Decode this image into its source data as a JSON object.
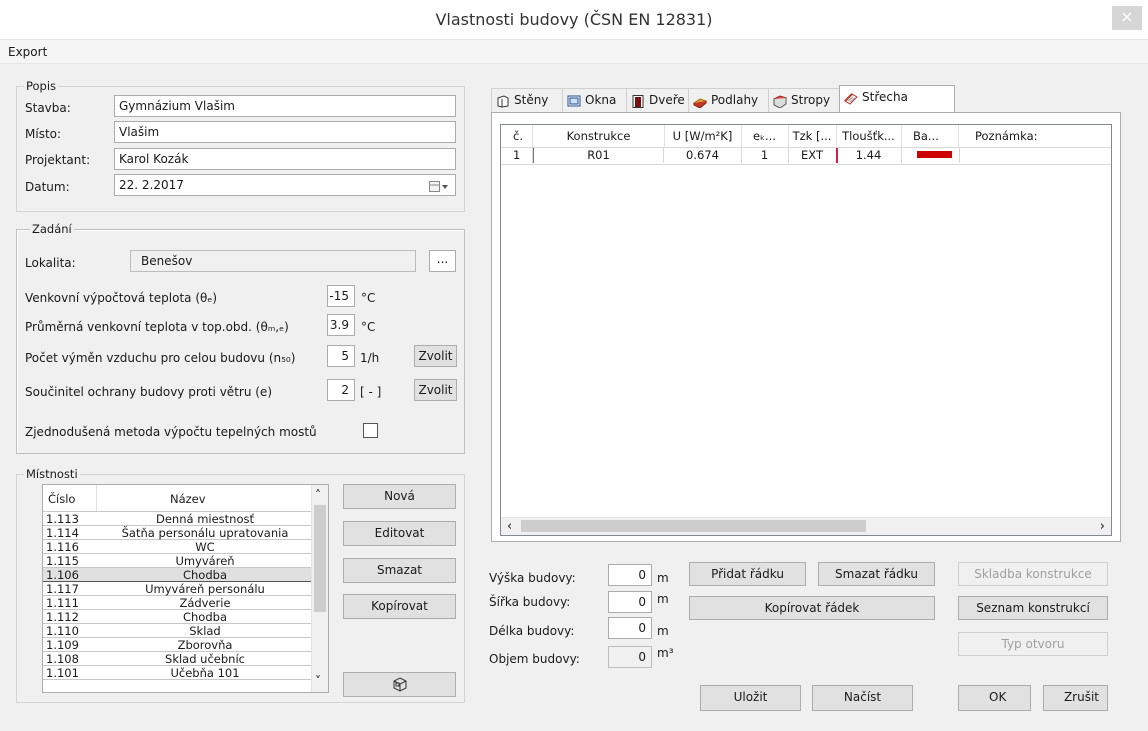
{
  "window": {
    "title": "Vlastnosti budovy (ČSN EN 12831)",
    "close_glyph": "×"
  },
  "menu": {
    "export": "Export"
  },
  "popis": {
    "group_label": "Popis",
    "stavba_label": "Stavba:",
    "stavba_value": "Gymnázium Vlašim",
    "misto_label": "Místo:",
    "misto_value": "Vlašim",
    "projektant_label": "Projektant:",
    "projektant_value": "Karol Kozák",
    "datum_label": "Datum:",
    "datum_value": "22. 2.2017"
  },
  "zadani": {
    "group_label": "Zadání",
    "lokalita_label": "Lokalita:",
    "lokalita_value": "Benešov",
    "lokalita_button": "...",
    "venkovni_label": "Venkovní výpočtová teplota (θₑ)",
    "venkovni_value": "-15",
    "venkovni_unit": "°C",
    "prumerna_label": "Průměrná venkovní teplota v top.obd. (θₘ,ₑ)",
    "prumerna_value": "3.9",
    "prumerna_unit": "°C",
    "vymen_label": "Počet výměn vzduchu pro celou budovu (n₅₀)",
    "vymen_value": "5",
    "vymen_unit": "1/h",
    "vymen_button": "Zvolit",
    "soucinitel_label": "Součinitel ochrany budovy proti větru (e)",
    "soucinitel_value": "2",
    "soucinitel_unit": "[ - ]",
    "soucinitel_button": "Zvolit",
    "zjednodusena_label": "Zjednodušená metoda výpočtu tepelných mostů",
    "zjednodusena_checked": false
  },
  "mistnosti": {
    "group_label": "Místnosti",
    "columns": [
      "Číslo",
      "Název"
    ],
    "rows": [
      {
        "cislo": "1.113",
        "nazev": "Denná miestnosť"
      },
      {
        "cislo": "1.114",
        "nazev": "Šatňa personálu upratovania"
      },
      {
        "cislo": "1.116",
        "nazev": "WC"
      },
      {
        "cislo": "1.115",
        "nazev": "Umyváreň"
      },
      {
        "cislo": "1.106",
        "nazev": "Chodba"
      },
      {
        "cislo": "1.117",
        "nazev": "Umyváreň personálu"
      },
      {
        "cislo": "1.111",
        "nazev": "Zádverie"
      },
      {
        "cislo": "1.112",
        "nazev": "Chodba"
      },
      {
        "cislo": "1.110",
        "nazev": "Sklad"
      },
      {
        "cislo": "1.109",
        "nazev": "Zborovňa"
      },
      {
        "cislo": "1.108",
        "nazev": "Sklad učebníc"
      },
      {
        "cislo": "1.101",
        "nazev": "Učebňa 101"
      }
    ],
    "selected_index": 4,
    "buttons": {
      "nova": "Nová",
      "editovat": "Editovat",
      "smazat": "Smazat",
      "kopirovat": "Kopírovat"
    }
  },
  "tabs": [
    {
      "label": "Stěny",
      "icon": "wall-icon"
    },
    {
      "label": "Okna",
      "icon": "window-icon"
    },
    {
      "label": "Dveře",
      "icon": "door-icon"
    },
    {
      "label": "Podlahy",
      "icon": "floor-icon"
    },
    {
      "label": "Stropy",
      "icon": "ceiling-icon"
    },
    {
      "label": "Střecha",
      "icon": "roof-icon",
      "active": true
    }
  ],
  "grid": {
    "columns": [
      "č.",
      "Konstrukce",
      "U [W/m²K]",
      "eₖ...",
      "Tzk [...",
      "Tloušťk...",
      "Ba...",
      "Poznámka:"
    ],
    "rows": [
      {
        "c": "1",
        "konstrukce": "R01",
        "u": "0.674",
        "e": "1",
        "tzk": "EXT",
        "tloustka": "1.44",
        "barva": "#cc0000",
        "poznamka": ""
      }
    ]
  },
  "budova": {
    "vyska_label": "Výška budovy:",
    "vyska_value": "0",
    "vyska_unit": "m",
    "sirka_label": "Šířka budovy:",
    "sirka_value": "0",
    "sirka_unit": "m",
    "delka_label": "Délka budovy:",
    "delka_value": "0",
    "delka_unit": "m",
    "objem_label": "Objem budovy:",
    "objem_value": "0",
    "objem_unit": "m³"
  },
  "actions": {
    "pridat_radku": "Přidat řádku",
    "smazat_radku": "Smazat řádku",
    "kopirovat_radek": "Kopírovat řádek",
    "skladba": "Skladba konstrukce",
    "seznam": "Seznam konstrukcí",
    "typ_otvoru": "Typ otvoru",
    "ulozit": "Uložit",
    "nacist": "Načíst",
    "ok": "OK",
    "zrusit": "Zrušit"
  },
  "colors": {
    "accent_red": "#cc0000",
    "selection": "#e0e0e0"
  }
}
